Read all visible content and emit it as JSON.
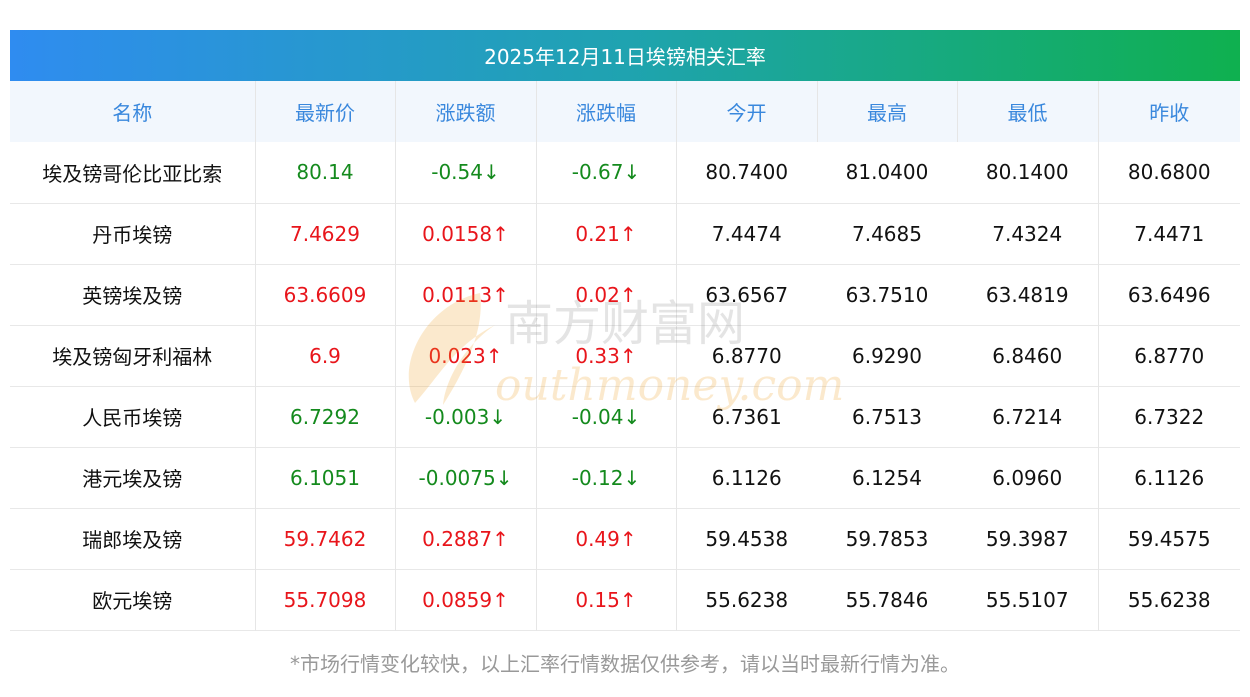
{
  "title": "2025年12月11日埃镑相关汇率",
  "headers": [
    "名称",
    "最新价",
    "涨跌额",
    "涨跌幅",
    "今开",
    "最高",
    "最低",
    "昨收"
  ],
  "rows": [
    {
      "name": "埃及镑哥伦比亚比索",
      "latest": "80.14",
      "change": "-0.54↓",
      "pct": "-0.67↓",
      "open": "80.7400",
      "high": "81.0400",
      "low": "80.1400",
      "prev": "80.6800",
      "dir": "down"
    },
    {
      "name": "丹币埃镑",
      "latest": "7.4629",
      "change": "0.0158↑",
      "pct": "0.21↑",
      "open": "7.4474",
      "high": "7.4685",
      "low": "7.4324",
      "prev": "7.4471",
      "dir": "up"
    },
    {
      "name": "英镑埃及镑",
      "latest": "63.6609",
      "change": "0.0113↑",
      "pct": "0.02↑",
      "open": "63.6567",
      "high": "63.7510",
      "low": "63.4819",
      "prev": "63.6496",
      "dir": "up"
    },
    {
      "name": "埃及镑匈牙利福林",
      "latest": "6.9",
      "change": "0.023↑",
      "pct": "0.33↑",
      "open": "6.8770",
      "high": "6.9290",
      "low": "6.8460",
      "prev": "6.8770",
      "dir": "up"
    },
    {
      "name": "人民币埃镑",
      "latest": "6.7292",
      "change": "-0.003↓",
      "pct": "-0.04↓",
      "open": "6.7361",
      "high": "6.7513",
      "low": "6.7214",
      "prev": "6.7322",
      "dir": "down"
    },
    {
      "name": "港元埃及镑",
      "latest": "6.1051",
      "change": "-0.0075↓",
      "pct": "-0.12↓",
      "open": "6.1126",
      "high": "6.1254",
      "low": "6.0960",
      "prev": "6.1126",
      "dir": "down"
    },
    {
      "name": "瑞郎埃及镑",
      "latest": "59.7462",
      "change": "0.2887↑",
      "pct": "0.49↑",
      "open": "59.4538",
      "high": "59.7853",
      "low": "59.3987",
      "prev": "59.4575",
      "dir": "up"
    },
    {
      "name": "欧元埃镑",
      "latest": "55.7098",
      "change": "0.0859↑",
      "pct": "0.15↑",
      "open": "55.6238",
      "high": "55.7846",
      "low": "55.5107",
      "prev": "55.6238",
      "dir": "up"
    }
  ],
  "footer": "*市场行情变化较快，以上汇率行情数据仅供参考，请以当时最新行情为准。",
  "watermark": {
    "cn": "南方财富网",
    "en": "outhmoney.com"
  },
  "colors": {
    "up": "#e8151b",
    "down": "#148a1d",
    "header_text": "#3a88dd"
  }
}
